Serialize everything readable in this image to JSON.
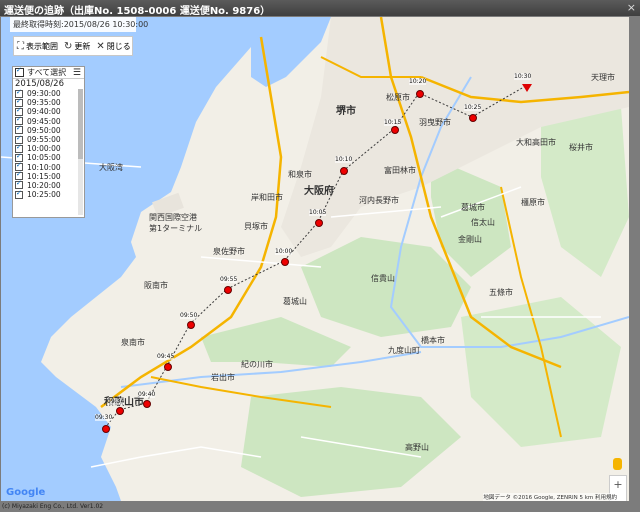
{
  "window": {
    "title": "運送便の追跡（出庫No. 1508-0006 運送便No. 9876）",
    "close_glyph": "×"
  },
  "info": {
    "last_updated": "最終取得時刻:2015/08/26 10:30:00"
  },
  "toolbar": {
    "range_label": "表示範囲",
    "refresh_label": "更新",
    "close_label": "閉じる"
  },
  "panel": {
    "select_all_label": "すべて選択",
    "date": "2015/08/26",
    "times": [
      "09:30:00",
      "09:35:00",
      "09:40:00",
      "09:45:00",
      "09:50:00",
      "09:55:00",
      "10:00:00",
      "10:05:00",
      "10:10:00",
      "10:15:00",
      "10:20:00",
      "10:25:00"
    ]
  },
  "markers": [
    {
      "label": "09:30"
    },
    {
      "label": "09:34"
    },
    {
      "label": "09:40"
    },
    {
      "label": "09:45"
    },
    {
      "label": "09:50"
    },
    {
      "label": "09:55"
    },
    {
      "label": "10:00"
    },
    {
      "label": "10:05"
    },
    {
      "label": "10:10"
    },
    {
      "label": "10:15"
    },
    {
      "label": "10:20"
    },
    {
      "label": "10:25"
    },
    {
      "label": "10:30"
    }
  ],
  "cities": {
    "sakai": "堺市",
    "osaka_fu": "大阪府",
    "izumi": "和泉市",
    "kishiwada": "岸和田市",
    "kaizuka": "貝塚市",
    "hannan": "阪南市",
    "wakayama": "和歌山市",
    "iwade": "岩出市",
    "kinokawa": "紀の川市",
    "hashimoto": "橋本市",
    "gojo": "五條市",
    "katsuragi": "葛城市",
    "kashihara": "橿原市",
    "sakurai": "桜井市",
    "tenri": "天理市",
    "yamatotakada": "大和高田市",
    "matsubara": "松原市",
    "habikino": "羽曳野市",
    "tondabayashi": "富田林市",
    "kawachinagano": "河内長野市",
    "izumisano": "泉佐野市",
    "ozaki_shimosen": "泉南市",
    "osaka_bay": "大阪湾",
    "kansai_airport": "関西国際空港 第1ターミナル",
    "kudoyama": "九度山町",
    "koya": "高野山",
    "katsuragi_mt": "葛城山",
    "kongo_mt": "金剛山",
    "ikoma": "信貴山",
    "shinoda": "信太山"
  },
  "map": {
    "google_logo": "Google",
    "attribution": "地図データ ©2016 Google, ZENRIN  5 km  利用規約",
    "zoom_in": "+",
    "zoom_out": "−"
  },
  "footer": {
    "copyright": "(c) Miyazaki Eng Co., Ltd. Ver1.02"
  },
  "colors": {
    "titlebar": "#4a4a4a",
    "sea": "#a3ccff",
    "land": "#f2efe7",
    "forest": "#cde6c1",
    "marker": "#e00000",
    "route": "#f5b400"
  }
}
